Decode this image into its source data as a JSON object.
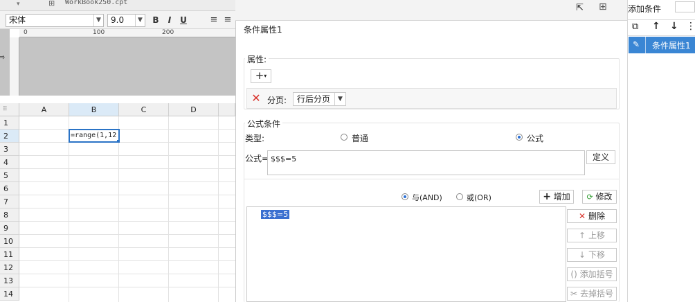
{
  "tab": {
    "file_name": "WorkBook250.cpt"
  },
  "toolbar": {
    "font_name": "宋体",
    "font_size": "9.0",
    "bold": "B",
    "italic": "I",
    "underline": "U"
  },
  "ruler": {
    "marks": [
      "0",
      "100",
      "200"
    ]
  },
  "sheet": {
    "columns": [
      "A",
      "B",
      "C",
      "D"
    ],
    "rows": [
      "1",
      "2",
      "3",
      "4",
      "5",
      "6",
      "7",
      "8",
      "9",
      "10",
      "11",
      "12",
      "13",
      "14"
    ],
    "selected_cell_value": "=range(1,12"
  },
  "dialog": {
    "title": "条件属性1",
    "attributes_label": "属性:",
    "add_symbol": "+",
    "page_break_label": "分页:",
    "page_break_value": "行后分页",
    "formula_group_label": "公式条件",
    "type_label": "类型:",
    "type_normal": "普通",
    "type_formula": "公式",
    "formula_label": "公式=",
    "formula_value": "$$$=5",
    "define_button": "定义",
    "and_label": "与(AND)",
    "or_label": "或(OR)",
    "add_button": "增加",
    "modify_button": "修改",
    "condition_item": "$$$=5",
    "delete_button": "删除",
    "move_up_button": "上移",
    "move_down_button": "下移",
    "add_bracket_button": "添加括号",
    "remove_bracket_button": "去掉括号"
  },
  "right_panel": {
    "title": "添加条件",
    "item_label": "条件属性1"
  },
  "colors": {
    "accent": "#3a86d4",
    "selection_border": "#2a73c6",
    "delete_red": "#d9322b"
  }
}
